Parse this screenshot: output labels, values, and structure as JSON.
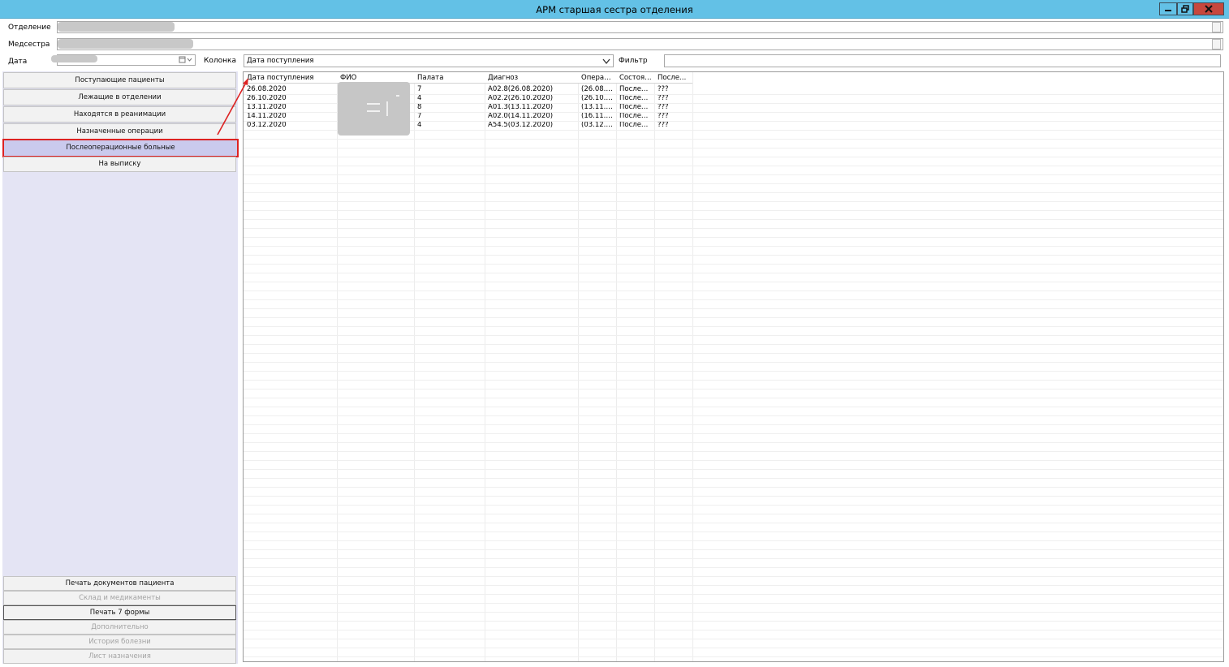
{
  "window": {
    "title": "АРМ старшая сестра отделения"
  },
  "form": {
    "department_label": "Отделение",
    "nurse_label": "Медсестра",
    "date_label": "Дата",
    "column_label": "Колонка",
    "column_value": "Дата поступления",
    "filter_label": "Фильтр",
    "filter_value": ""
  },
  "nav": {
    "items": [
      {
        "label": "Поступающие пациенты"
      },
      {
        "label": "Лежащие в отделении"
      },
      {
        "label": "Находятся в реанимации"
      },
      {
        "label": "Назначенные операции"
      },
      {
        "label": "Послеоперационные больные",
        "selected": true
      },
      {
        "label": "На выписку"
      }
    ],
    "bottom_items": [
      {
        "label": "Печать документов пациента",
        "enabled": true
      },
      {
        "label": "Склад и медикаменты",
        "enabled": false
      },
      {
        "label": "Печать 7 формы",
        "enabled": true
      },
      {
        "label": "Дополнительно",
        "enabled": false
      },
      {
        "label": "История болезни",
        "enabled": false
      },
      {
        "label": "Лист назначения",
        "enabled": false
      }
    ]
  },
  "grid": {
    "columns": [
      "Дата поступления",
      "ФИО",
      "Палата",
      "Диагноз",
      "Опера…",
      "Состоя…",
      "После…"
    ],
    "rows": [
      [
        "26.08.2020",
        "",
        "7",
        "A02.8(26.08.2020)",
        "(26.08.…",
        "После…",
        "???"
      ],
      [
        "26.10.2020",
        "",
        "4",
        "A02.2(26.10.2020)",
        "(26.10.…",
        "После…",
        "???"
      ],
      [
        "13.11.2020",
        "",
        "8",
        "A01.3(13.11.2020)",
        "(13.11.…",
        "После…",
        "???"
      ],
      [
        "14.11.2020",
        "",
        "7",
        "A02.0(14.11.2020)",
        "(16.11.…",
        "После…",
        "???"
      ],
      [
        "03.12.2020",
        "",
        "4",
        "A54.5(03.12.2020)",
        "(03.12.…",
        "После…",
        "???"
      ]
    ]
  },
  "colors": {
    "titlebar": "#63c1e6",
    "close_button": "#c7473d",
    "left_panel": "#e4e4f4",
    "selected_item": "#cacaed",
    "highlight": "#dd2222"
  },
  "icons": [
    "minimize-icon",
    "restore-icon",
    "close-icon",
    "calendar-icon",
    "chevron-down-icon",
    "ellipsis-icon"
  ]
}
